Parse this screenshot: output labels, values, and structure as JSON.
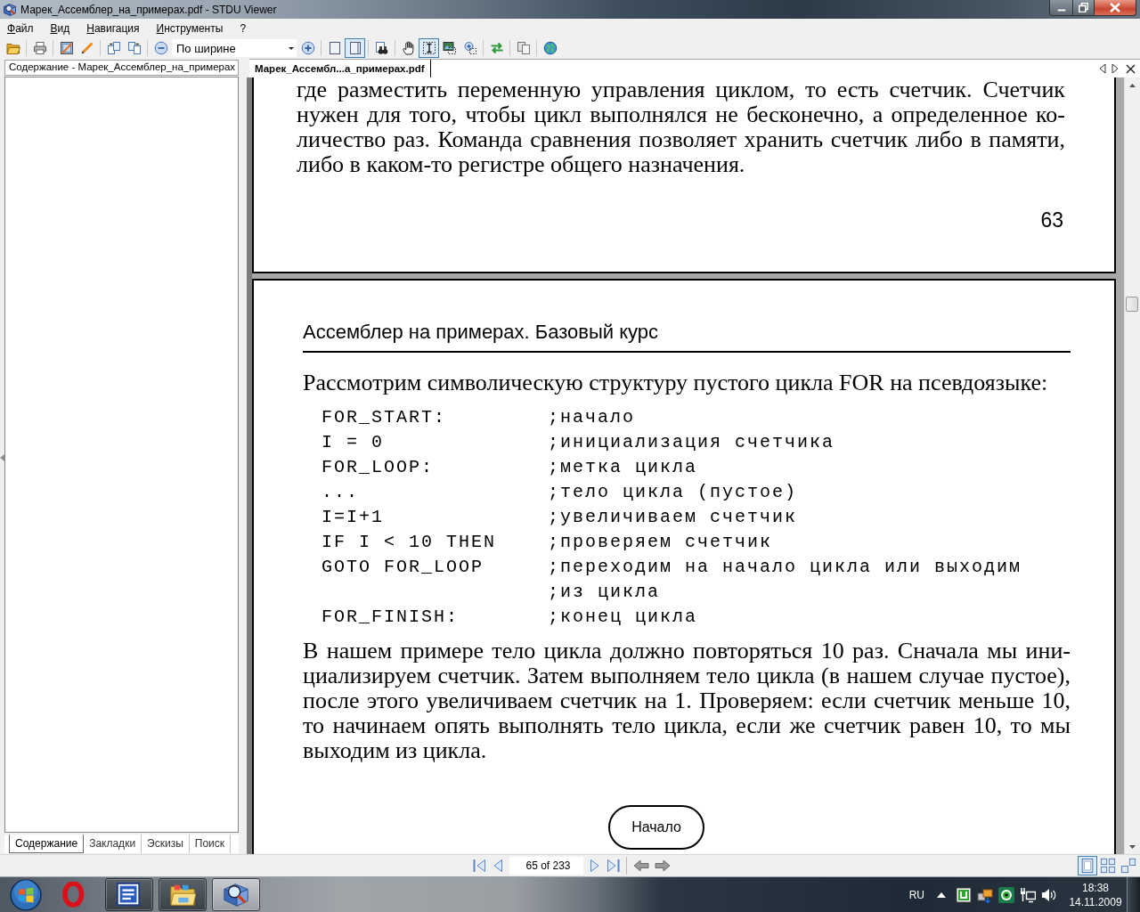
{
  "window": {
    "title": "Марек_Ассемблер_на_примерах.pdf - STDU Viewer"
  },
  "menu": [
    "Файл",
    "Вид",
    "Навигация",
    "Инструменты",
    "?"
  ],
  "toolbar": {
    "items": [
      {
        "kind": "button",
        "selected": false
      },
      {
        "kind": "separator"
      },
      {
        "kind": "button",
        "selected": false
      },
      {
        "kind": "separator"
      },
      {
        "kind": "button",
        "selected": false
      },
      {
        "kind": "button",
        "selected": false
      },
      {
        "kind": "separator"
      },
      {
        "kind": "button",
        "selected": false
      },
      {
        "kind": "button",
        "selected": false
      },
      {
        "kind": "separator"
      },
      {
        "kind": "button",
        "selected": false
      },
      {
        "kind": "select",
        "value": "По ширине"
      },
      {
        "kind": "button",
        "selected": false
      },
      {
        "kind": "separator"
      },
      {
        "kind": "button",
        "selected": false
      },
      {
        "kind": "button",
        "selected": true
      },
      {
        "kind": "separator"
      },
      {
        "kind": "button",
        "selected": false
      },
      {
        "kind": "separator"
      },
      {
        "kind": "button",
        "selected": false
      },
      {
        "kind": "button",
        "selected": true
      },
      {
        "kind": "button",
        "selected": false
      },
      {
        "kind": "button",
        "selected": false
      },
      {
        "kind": "separator"
      },
      {
        "kind": "button",
        "selected": false
      },
      {
        "kind": "separator"
      },
      {
        "kind": "button",
        "selected": false
      },
      {
        "kind": "separator"
      },
      {
        "kind": "button",
        "selected": false
      }
    ]
  },
  "sidebar": {
    "header": "Содержание - Марек_Ассемблер_на_примерах",
    "tabs": [
      {
        "label": "Содержание",
        "selected": true
      },
      {
        "label": "Закладки",
        "selected": false
      },
      {
        "label": "Эскизы",
        "selected": false
      },
      {
        "label": "Поиск",
        "selected": false
      }
    ]
  },
  "document_tabs": [
    {
      "label": "Марек_Ассембл...а_примерах.pdf",
      "selected": true
    }
  ],
  "document": {
    "pages": [
      {
        "blocks": [
          {
            "kind": "paragraph",
            "lines": [
              "где разместить переменную управления циклом, то есть счетчик. Счетчик",
              "нужен для того, чтобы цикл выполнялся не бесконечно, а определенное ко-",
              "личество раз. Команда сравнения позволяет хранить счетчик либо в памяти,",
              "либо в каком-то регистре общего назначения."
            ]
          },
          {
            "kind": "page_number",
            "text": "63"
          }
        ]
      },
      {
        "blocks": [
          {
            "kind": "running_head",
            "text": "Ассемблер на примерах. Базовый курс"
          },
          {
            "kind": "paragraph",
            "lines": [
              "Рассмотрим символическую структуру пустого цикла FOR на псевдоязыке:"
            ]
          },
          {
            "kind": "code",
            "rows": [
              {
                "code": "FOR_START:",
                "comment": ";начало"
              },
              {
                "code": "I = 0",
                "comment": ";инициализация счетчика"
              },
              {
                "code": "FOR_LOOP:",
                "comment": ";метка цикла"
              },
              {
                "code": "...",
                "comment": ";тело цикла (пустое)"
              },
              {
                "code": "I=I+1",
                "comment": ";увеличиваем счетчик"
              },
              {
                "code": "IF I < 10 THEN",
                "comment": ";проверяем счетчик"
              },
              {
                "code": "GOTO FOR_LOOP",
                "comment": ";переходим на начало цикла или выходим"
              },
              {
                "comment": ";из цикла"
              },
              {
                "code": "FOR_FINISH:",
                "comment": ";конец цикла"
              }
            ]
          },
          {
            "kind": "paragraph",
            "lines": [
              "В нашем примере тело цикла должно повторяться 10 раз. Сначала мы ини-",
              "циализируем счетчик. Затем выполняем тело цикла (в нашем случае пустое),",
              "после этого увеличиваем счетчик на 1. Проверяем: если счетчик меньше 10,",
              "то начинаем опять выполнять тело цикла, если же счетчик равен 10, то мы",
              "выходим из цикла."
            ]
          },
          {
            "kind": "flowchart",
            "start": "Начало"
          }
        ]
      }
    ]
  },
  "navigation_bar": {
    "page_field": "65 of 233",
    "view_modes": [
      {
        "selected": true
      },
      {
        "selected": false
      },
      {
        "selected": false
      }
    ]
  },
  "taskbar": {
    "apps": [
      {
        "running": false,
        "selected": false
      },
      {
        "running": true,
        "selected": false
      },
      {
        "running": true,
        "selected": false
      },
      {
        "running": true,
        "selected": true
      }
    ],
    "language": "RU",
    "clock": {
      "time": "18:38",
      "date": "14.11.2009"
    }
  }
}
